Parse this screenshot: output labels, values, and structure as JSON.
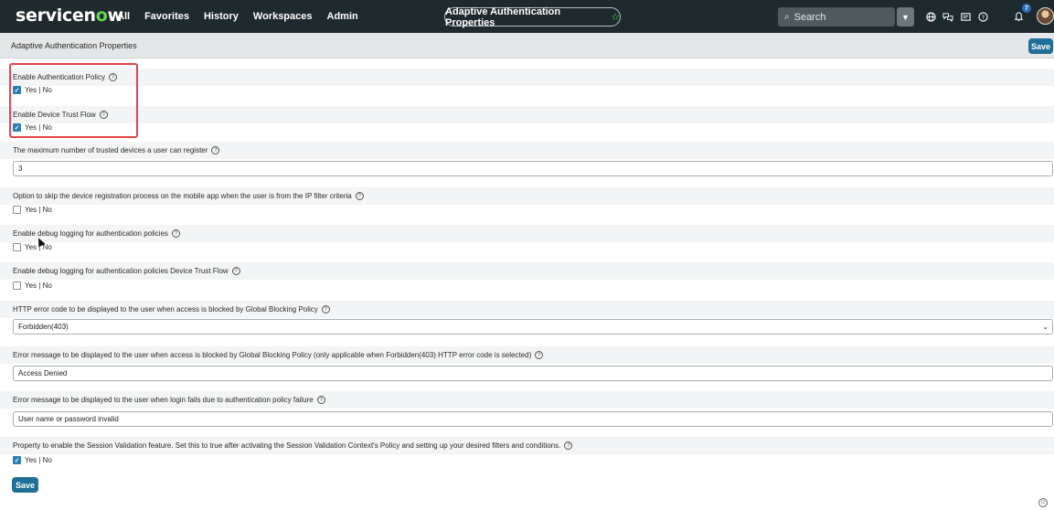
{
  "nav": {
    "logo_prefix": "servicen",
    "logo_o": "o",
    "logo_suffix": "w",
    "items": [
      "All",
      "Favorites",
      "History",
      "Workspaces",
      "Admin"
    ],
    "page_title": "Adaptive Authentication Properties",
    "search_placeholder": "Search",
    "notification_count": "7",
    "icons": [
      "globe-icon",
      "chat-icon",
      "inbox-icon",
      "help-icon",
      "bell-icon"
    ]
  },
  "header": {
    "title": "Adaptive Authentication Properties",
    "save_label": "Save"
  },
  "properties": [
    {
      "label": "Enable Authentication Policy",
      "type": "checkbox",
      "checked": true,
      "yesno": "Yes | No"
    },
    {
      "label": "Enable Device Trust Flow",
      "type": "checkbox",
      "checked": true,
      "yesno": "Yes | No"
    },
    {
      "label": "The maximum number of trusted devices a user can register",
      "type": "text",
      "value": "3"
    },
    {
      "label": "Option to skip the device registration process on the mobile app when the user is from the IP filter criteria",
      "type": "checkbox",
      "checked": false,
      "yesno": "Yes | No"
    },
    {
      "label": "Enable debug logging for authentication policies",
      "type": "checkbox",
      "checked": false,
      "yesno": "Yes | No"
    },
    {
      "label": "Enable debug logging for authentication policies Device Trust Flow",
      "type": "checkbox",
      "checked": false,
      "yesno": "Yes | No"
    },
    {
      "label": "HTTP error code to be displayed to the user when access is blocked by Global Blocking Policy",
      "type": "select",
      "value": "Forbidden(403)"
    },
    {
      "label": "Error message to be displayed to the user when access is blocked by Global Blocking Policy (only applicable when Forbidden(403) HTTP error code is selected)",
      "type": "text",
      "value": "Access Denied"
    },
    {
      "label": "Error message to be displayed to the user when login fails due to authentication policy failure",
      "type": "text",
      "value": "User name or password invalid"
    },
    {
      "label": "Property to enable the Session Validation feature. Set this to true after activating the Session Validation Context's Policy and setting up your desired filters and conditions.",
      "type": "checkbox",
      "checked": true,
      "yesno": "Yes | No"
    }
  ],
  "footer": {
    "save_label": "Save"
  },
  "colors": {
    "nav_bg": "#1f2a2e",
    "accent": "#1f6f97",
    "checkbox_checked": "#2b7fb0",
    "highlight": "#e0454a"
  }
}
